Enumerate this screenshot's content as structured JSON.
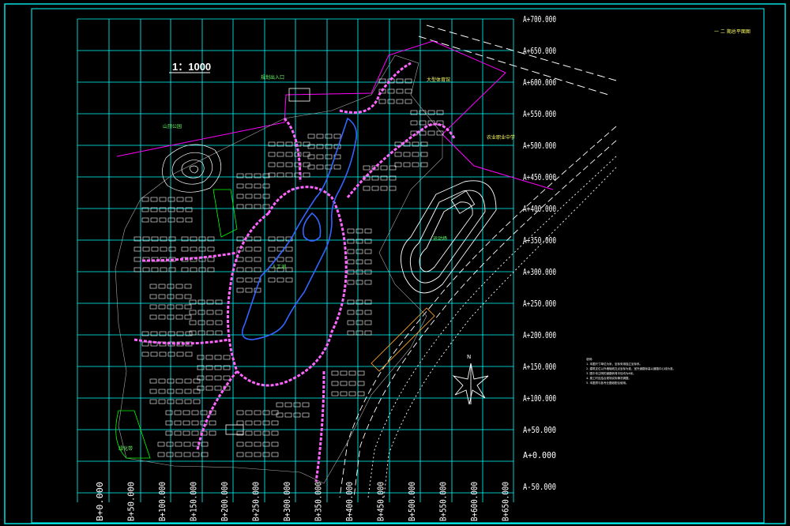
{
  "drawing": {
    "scale_label": "1：1000",
    "title_block_label": "一 二 期总平面图",
    "north_label": "N"
  },
  "grid": {
    "a_axis": [
      "A+700.000",
      "A+650.000",
      "A+600.000",
      "A+550.000",
      "A+500.000",
      "A+450.000",
      "A+400.000",
      "A+350.000",
      "A+300.000",
      "A+250.000",
      "A+200.000",
      "A+150.000",
      "A+100.000",
      "A+50.000",
      "A+0.000",
      "A-50.000"
    ],
    "b_axis": [
      "B+0.000",
      "B+50.000",
      "B+100.000",
      "B+150.000",
      "B+200.000",
      "B+250.000",
      "B+300.000",
      "B+350.000",
      "B+400.000",
      "B+450.000",
      "B+500.000",
      "B+550.000",
      "B+600.000",
      "B+650.000"
    ]
  },
  "annotations": {
    "hill": "山顶公园",
    "entrance": "规划出入口",
    "school": "大型体育馆",
    "middle_school": "农业职业中学",
    "playground": "运动场",
    "lake": "人工湖",
    "green": "绿化带"
  },
  "notes": [
    "说明：",
    "1. 本图尺寸单位为米，坐标采用独立坐标系。",
    "2. 建筑定位以外墙轴线交点坐标为准，室外道路标高以道路中心线为准。",
    "3. 图中未注明的道路转弯半径均为6米。",
    "4. 施工时应结合现场实际情况调整。",
    "5. 本图须与各专业图纸配合使用。"
  ],
  "colors": {
    "frame": "#00ffff",
    "grid": "#00ffff",
    "roads": "#ff66ff",
    "boundary": "#ff00ff",
    "buildings": "#ffffff",
    "water": "#3366ff",
    "green": "#00ff00",
    "highlight": "#ffff00"
  }
}
